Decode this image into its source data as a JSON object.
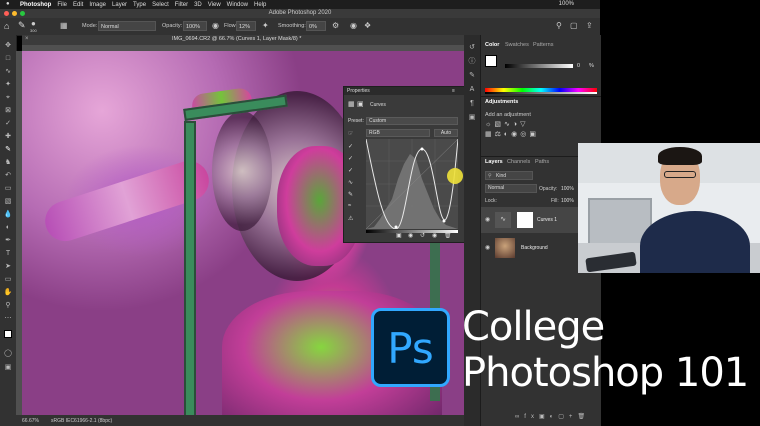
{
  "menubar": {
    "app_name": "Photoshop",
    "items": [
      "File",
      "Edit",
      "Image",
      "Layer",
      "Type",
      "Select",
      "Filter",
      "3D",
      "View",
      "Window",
      "Help"
    ],
    "battery": "100%"
  },
  "window": {
    "title": "Adobe Photoshop 2020"
  },
  "options_bar": {
    "brush_size": "300",
    "mode_label": "Mode:",
    "mode_value": "Normal",
    "opacity_label": "Opacity:",
    "opacity_value": "100%",
    "flow_label": "Flow:",
    "flow_value": "12%",
    "smoothing_label": "Smoothing:",
    "smoothing_value": "0%"
  },
  "document": {
    "tab_title": "IMG_0694.CR2 @ 66.7% (Curves 1, Layer Mask/8) *",
    "zoom": "66.67%",
    "color_profile": "sRGB IEC61966-2.1 (8bpc)"
  },
  "properties_panel": {
    "title": "Properties",
    "adjustment_name": "Curves",
    "preset_label": "Preset:",
    "preset_value": "Custom",
    "channel_value": "RGB",
    "auto_label": "Auto"
  },
  "color_panel": {
    "tabs": [
      "Color",
      "Swatches",
      "Patterns"
    ],
    "slider_value": "0",
    "slider_unit": "%"
  },
  "adjustments_panel": {
    "title": "Adjustments",
    "subtitle": "Add an adjustment"
  },
  "layers_panel": {
    "tabs": [
      "Layers",
      "Channels",
      "Paths"
    ],
    "kind_label": "Kind",
    "blend_mode": "Normal",
    "opacity_label": "Opacity:",
    "opacity_value": "100%",
    "lock_label": "Lock:",
    "fill_label": "Fill:",
    "fill_value": "100%",
    "layers": [
      {
        "name": "Curves 1"
      },
      {
        "name": "Background"
      }
    ]
  },
  "overlay": {
    "logo_text": "Ps",
    "title_line1": "College",
    "title_line2": "Photoshop 101"
  },
  "colors": {
    "ps_blue": "#31a8ff",
    "ps_navy": "#001e36",
    "ui_dark": "#323232"
  }
}
